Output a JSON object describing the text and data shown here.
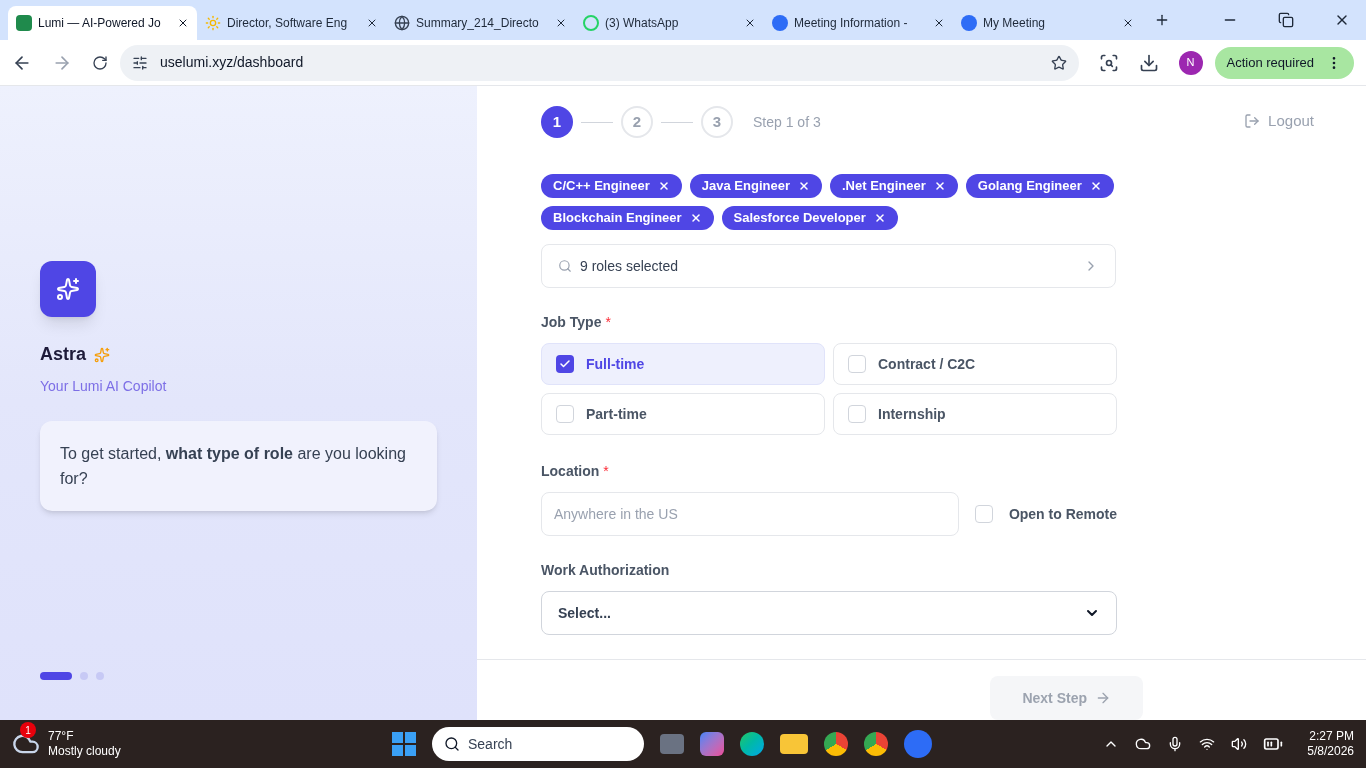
{
  "browser": {
    "tabs": [
      {
        "title": "Lumi — AI-Powered Jo",
        "kind": "lumi",
        "selected": true
      },
      {
        "title": "Director, Software Eng",
        "kind": "spark",
        "selected": false
      },
      {
        "title": "Summary_214_Directo",
        "kind": "globe",
        "selected": false
      },
      {
        "title": "(3) WhatsApp",
        "kind": "whatsapp",
        "selected": false
      },
      {
        "title": "Meeting Information -",
        "kind": "zoom",
        "selected": false
      },
      {
        "title": "My Meeting",
        "kind": "zoom",
        "selected": false
      }
    ],
    "url": "uselumi.xyz/dashboard",
    "profile_initial": "N",
    "action_button": "Action required"
  },
  "assistant": {
    "name": "Astra",
    "subtitle": "Your Lumi AI Copilot",
    "message": "To get started, **what type of role** are you looking for?",
    "dots": [
      {
        "selected": true
      },
      {
        "selected": false
      },
      {
        "selected": false
      }
    ]
  },
  "stepper": {
    "steps": [
      {
        "label": "1",
        "selected": true
      },
      {
        "label": "2",
        "selected": false
      },
      {
        "label": "3",
        "selected": false
      }
    ],
    "caption": "Step 1 of 3"
  },
  "logout": "Logout",
  "role_chips": [
    {
      "label": "C/C++ Engineer"
    },
    {
      "label": "Java Engineer"
    },
    {
      "label": ".Net Engineer"
    },
    {
      "label": "Golang Engineer"
    },
    {
      "label": "Blockchain Engineer"
    },
    {
      "label": "Salesforce Developer"
    }
  ],
  "roles_field": {
    "value": "9 roles selected"
  },
  "job_type": {
    "label": "Job Type",
    "required_mark": "*",
    "options": [
      {
        "label": "Full-time",
        "checked": true
      },
      {
        "label": "Contract / C2C",
        "checked": false
      },
      {
        "label": "Part-time",
        "checked": false
      },
      {
        "label": "Internship",
        "checked": false
      }
    ]
  },
  "location": {
    "label": "Location",
    "required_mark": "*",
    "placeholder": "Anywhere in the US",
    "remote": {
      "label": "Open to Remote",
      "checked": false
    }
  },
  "work_authorization": {
    "label": "Work Authorization",
    "value": "Select..."
  },
  "next_button": {
    "label": "Next Step",
    "disabled": true
  },
  "taskbar": {
    "weather": {
      "temp": "77°F",
      "condition": "Mostly cloudy",
      "badge": "1"
    },
    "search": "Search",
    "time": "2:27 PM",
    "date": "5/8/2026"
  }
}
